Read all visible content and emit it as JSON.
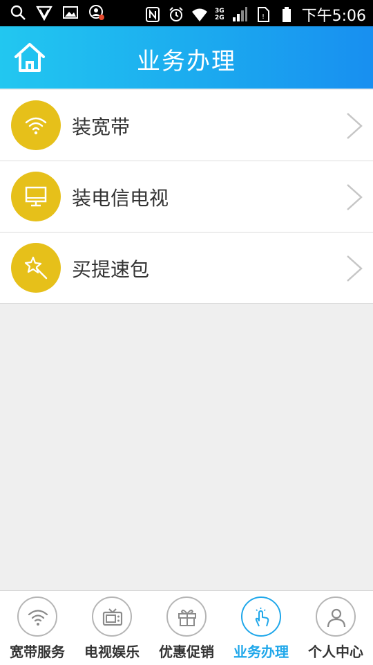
{
  "status_bar": {
    "time": "下午5:06",
    "network_labels": [
      "3G",
      "2G"
    ],
    "left_icons": [
      "search-icon",
      "shield-icon",
      "image-icon",
      "alert-user-icon"
    ],
    "right_icons": [
      "nfc-icon",
      "alarm-icon",
      "wifi-icon",
      "signal-icon",
      "sim-icon",
      "battery-icon"
    ]
  },
  "header": {
    "title": "业务办理",
    "home_icon": "home-icon",
    "background_colors": [
      "#22c7f0",
      "#188ff0"
    ]
  },
  "menu": {
    "items": [
      {
        "label": "装宽带",
        "icon": "wifi-icon"
      },
      {
        "label": "装电信电视",
        "icon": "monitor-icon"
      },
      {
        "label": "买提速包",
        "icon": "magic-wand-icon"
      }
    ],
    "icon_color": "#e6c01a"
  },
  "tabbar": {
    "active_color": "#1fa7ea",
    "tabs": [
      {
        "label": "宽带服务",
        "icon": "wifi-icon"
      },
      {
        "label": "电视娱乐",
        "icon": "tv-icon"
      },
      {
        "label": "优惠促销",
        "icon": "gift-icon"
      },
      {
        "label": "业务办理",
        "icon": "touch-hand-icon",
        "active": true
      },
      {
        "label": "个人中心",
        "icon": "person-icon"
      }
    ]
  }
}
